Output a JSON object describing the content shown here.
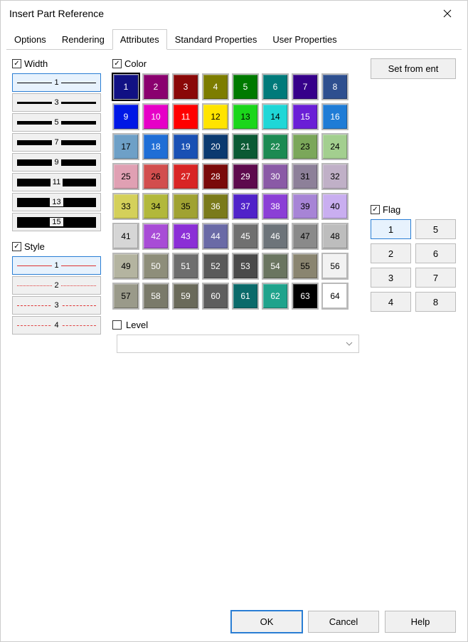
{
  "window": {
    "title": "Insert Part Reference"
  },
  "tabs": {
    "options": "Options",
    "rendering": "Rendering",
    "attributes": "Attributes",
    "standard": "Standard Properties",
    "user": "User Properties",
    "active": "attributes"
  },
  "width": {
    "label": "Width",
    "checked": true,
    "selected": 1,
    "items": [
      {
        "v": 1,
        "h": 1
      },
      {
        "v": 3,
        "h": 3
      },
      {
        "v": 5,
        "h": 5
      },
      {
        "v": 7,
        "h": 7
      },
      {
        "v": 9,
        "h": 9
      },
      {
        "v": 11,
        "h": 11
      },
      {
        "v": 13,
        "h": 13
      },
      {
        "v": 15,
        "h": 15
      }
    ]
  },
  "style": {
    "label": "Style",
    "checked": true,
    "selected": 1,
    "items": [
      {
        "v": 1,
        "css": "border-top:1px solid #d33;"
      },
      {
        "v": 2,
        "css": "border-top:1px dotted #d33;"
      },
      {
        "v": 3,
        "css": "border-top:1px dashed #d33;"
      },
      {
        "v": 4,
        "css": "border-top:1px dashed #d33; opacity:.9;"
      }
    ]
  },
  "color": {
    "label": "Color",
    "checked": true,
    "selected": 1,
    "swatches": [
      {
        "n": 1,
        "c": "#111184",
        "t": "#fff"
      },
      {
        "n": 2,
        "c": "#8a006f",
        "t": "#fff"
      },
      {
        "n": 3,
        "c": "#8a0808",
        "t": "#fff"
      },
      {
        "n": 4,
        "c": "#7d7d00",
        "t": "#fff"
      },
      {
        "n": 5,
        "c": "#007a00",
        "t": "#fff"
      },
      {
        "n": 6,
        "c": "#007a7a",
        "t": "#fff"
      },
      {
        "n": 7,
        "c": "#36008a",
        "t": "#fff"
      },
      {
        "n": 8,
        "c": "#2e4f8f",
        "t": "#fff"
      },
      {
        "n": 9,
        "c": "#0018e6",
        "t": "#fff"
      },
      {
        "n": 10,
        "c": "#e600c7",
        "t": "#fff"
      },
      {
        "n": 11,
        "c": "#ff0000",
        "t": "#fff"
      },
      {
        "n": 12,
        "c": "#ffe400",
        "t": "#000"
      },
      {
        "n": 13,
        "c": "#1bd61b",
        "t": "#000"
      },
      {
        "n": 14,
        "c": "#1fd7d7",
        "t": "#000"
      },
      {
        "n": 15,
        "c": "#6a1fd6",
        "t": "#fff"
      },
      {
        "n": 16,
        "c": "#1f7cd6",
        "t": "#fff"
      },
      {
        "n": 17,
        "c": "#6ea0c7",
        "t": "#000"
      },
      {
        "n": 18,
        "c": "#1f6ed6",
        "t": "#fff"
      },
      {
        "n": 19,
        "c": "#1950b4",
        "t": "#fff"
      },
      {
        "n": 20,
        "c": "#0b3a70",
        "t": "#fff"
      },
      {
        "n": 21,
        "c": "#0b5a34",
        "t": "#fff"
      },
      {
        "n": 22,
        "c": "#1c8a52",
        "t": "#fff"
      },
      {
        "n": 23,
        "c": "#7ba75a",
        "t": "#000"
      },
      {
        "n": 24,
        "c": "#a3cf8f",
        "t": "#000"
      },
      {
        "n": 25,
        "c": "#e0a0b3",
        "t": "#000"
      },
      {
        "n": 26,
        "c": "#d24e4e",
        "t": "#000"
      },
      {
        "n": 27,
        "c": "#d82424",
        "t": "#fff"
      },
      {
        "n": 28,
        "c": "#7a0a0a",
        "t": "#fff"
      },
      {
        "n": 29,
        "c": "#5d0a4d",
        "t": "#fff"
      },
      {
        "n": 30,
        "c": "#8a5aa6",
        "t": "#fff"
      },
      {
        "n": 31,
        "c": "#8d8099",
        "t": "#000"
      },
      {
        "n": 32,
        "c": "#c0b0c7",
        "t": "#000"
      },
      {
        "n": 33,
        "c": "#d4d05a",
        "t": "#000"
      },
      {
        "n": 34,
        "c": "#b2b83b",
        "t": "#000"
      },
      {
        "n": 35,
        "c": "#a0a232",
        "t": "#000"
      },
      {
        "n": 36,
        "c": "#7a7a1a",
        "t": "#fff"
      },
      {
        "n": 37,
        "c": "#5022c9",
        "t": "#fff"
      },
      {
        "n": 38,
        "c": "#8b3fd6",
        "t": "#fff"
      },
      {
        "n": 39,
        "c": "#a784d6",
        "t": "#000"
      },
      {
        "n": 40,
        "c": "#c9aef0",
        "t": "#000"
      },
      {
        "n": 41,
        "c": "#d6d6d6",
        "t": "#000"
      },
      {
        "n": 42,
        "c": "#a84cd6",
        "t": "#fff"
      },
      {
        "n": 43,
        "c": "#8b2fd6",
        "t": "#fff"
      },
      {
        "n": 44,
        "c": "#6a6aa6",
        "t": "#fff"
      },
      {
        "n": 45,
        "c": "#707070",
        "t": "#fff"
      },
      {
        "n": 46,
        "c": "#6d747a",
        "t": "#fff"
      },
      {
        "n": 47,
        "c": "#8a8a8a",
        "t": "#000"
      },
      {
        "n": 48,
        "c": "#bdbdbd",
        "t": "#000"
      },
      {
        "n": 49,
        "c": "#b4b4a0",
        "t": "#000"
      },
      {
        "n": 50,
        "c": "#8e8e7a",
        "t": "#fff"
      },
      {
        "n": 51,
        "c": "#6e6e6e",
        "t": "#fff"
      },
      {
        "n": 52,
        "c": "#5a5a5a",
        "t": "#fff"
      },
      {
        "n": 53,
        "c": "#4a4a4a",
        "t": "#fff"
      },
      {
        "n": 54,
        "c": "#6a7560",
        "t": "#fff"
      },
      {
        "n": 55,
        "c": "#8a8570",
        "t": "#000"
      },
      {
        "n": 56,
        "c": "#f2f2f2",
        "t": "#000"
      },
      {
        "n": 57,
        "c": "#9a9a8a",
        "t": "#000"
      },
      {
        "n": 58,
        "c": "#7a7a6a",
        "t": "#fff"
      },
      {
        "n": 59,
        "c": "#6a6a5a",
        "t": "#fff"
      },
      {
        "n": 60,
        "c": "#5e5e5e",
        "t": "#fff"
      },
      {
        "n": 61,
        "c": "#0a6a6a",
        "t": "#fff"
      },
      {
        "n": 62,
        "c": "#1fa38c",
        "t": "#fff"
      },
      {
        "n": 63,
        "c": "#000000",
        "t": "#fff"
      },
      {
        "n": 64,
        "c": "#ffffff",
        "t": "#000"
      }
    ]
  },
  "set_from_ent": "Set from ent",
  "flag": {
    "label": "Flag",
    "checked": true,
    "selected": 1,
    "items": [
      1,
      5,
      2,
      6,
      3,
      7,
      4,
      8
    ]
  },
  "level": {
    "label": "Level",
    "checked": false,
    "value": ""
  },
  "footer": {
    "ok": "OK",
    "cancel": "Cancel",
    "help": "Help"
  }
}
